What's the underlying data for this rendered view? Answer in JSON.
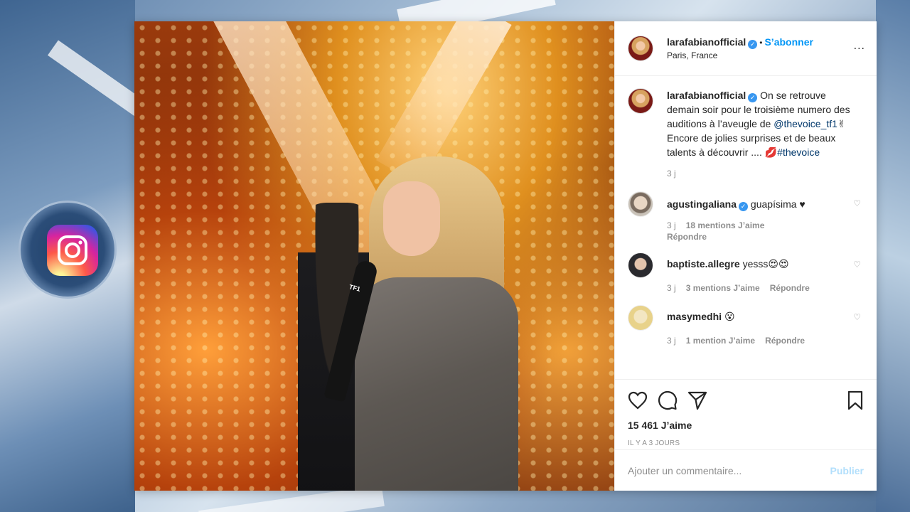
{
  "post": {
    "username": "larafabianofficial",
    "location": "Paris, France",
    "follow_label": "S’abonner",
    "more_label": "...",
    "verified_glyph": "✓",
    "dot": "•",
    "mic_label": "TF1"
  },
  "caption": {
    "username": "larafabianofficial",
    "text_1": "On se retrouve demain soir pour le troisième numero des auditions à l’aveugle de ",
    "mention": "@thevoice_tf1",
    "text_2": "✌",
    "text_3": "Encore de jolies surprises et de beaux talents à découvrir .... 💋",
    "hashtag": "#thevoice",
    "age": "3 j"
  },
  "comments": [
    {
      "username": "agustingaliana",
      "verified": true,
      "text": "guapísima ♥",
      "age": "3 j",
      "likes": "18 mentions J’aime",
      "reply": "Répondre",
      "avatar_color": "#c9c2b8"
    },
    {
      "username": "baptiste.allegre",
      "verified": false,
      "text": "yesss😍😍",
      "age": "3 j",
      "likes": "3 mentions J’aime",
      "reply": "Répondre",
      "avatar_color": "#3a3a3e"
    },
    {
      "username": "masymedhi",
      "verified": false,
      "text": "😮",
      "age": "3 j",
      "likes": "1 mention J’aime",
      "reply": "Répondre",
      "avatar_color": "#e8d28a"
    }
  ],
  "actions": {
    "like_icon": "heart-outline-icon",
    "comment_icon": "comment-bubble-icon",
    "share_icon": "paper-plane-icon",
    "save_icon": "bookmark-icon",
    "likes_count": "15 461 J’aime",
    "timestamp": "IL Y A 3 JOURS"
  },
  "add_comment": {
    "placeholder": "Ajouter un commentaire...",
    "publish_label": "Publier"
  },
  "colors": {
    "link_blue": "#0095f6",
    "verified_blue": "#3897f0",
    "muted": "#8e8e8e",
    "publish_disabled": "#b2dffc"
  }
}
